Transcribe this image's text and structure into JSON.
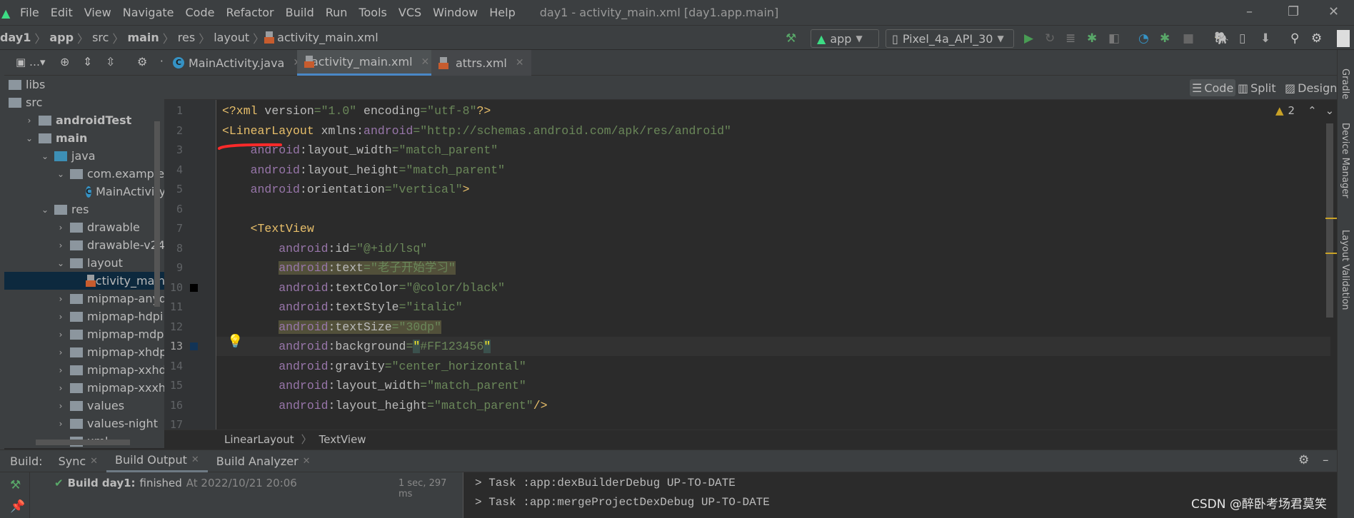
{
  "window": {
    "title": "day1 - activity_main.xml [day1.app.main]",
    "menu": [
      "File",
      "Edit",
      "View",
      "Navigate",
      "Code",
      "Refactor",
      "Build",
      "Run",
      "Tools",
      "VCS",
      "Window",
      "Help"
    ]
  },
  "navbar": {
    "breadcrumbs": [
      "day1",
      "app",
      "src",
      "main",
      "res",
      "layout",
      "activity_main.xml"
    ],
    "run_config": "app",
    "device": "Pixel_4a_API_30"
  },
  "tabs": [
    {
      "label": "MainActivity.java",
      "icon": "java-class-icon",
      "active": false
    },
    {
      "label": "activity_main.xml",
      "icon": "xml-file-icon",
      "active": true
    },
    {
      "label": "attrs.xml",
      "icon": "xml-file-icon",
      "active": false
    }
  ],
  "view_modes": {
    "code": "Code",
    "split": "Split",
    "design": "Design",
    "active": "Code"
  },
  "project_tree": [
    {
      "label": "libs",
      "depth": 0,
      "chev": "",
      "bold": false
    },
    {
      "label": "src",
      "depth": 0,
      "chev": "",
      "bold": false
    },
    {
      "label": "androidTest",
      "depth": 1,
      "chev": "›",
      "bold": true
    },
    {
      "label": "main",
      "depth": 1,
      "chev": "⌄",
      "bold": true
    },
    {
      "label": "java",
      "depth": 2,
      "chev": "⌄",
      "bold": false,
      "blue": true
    },
    {
      "label": "com.example.day",
      "depth": 3,
      "chev": "⌄",
      "bold": false
    },
    {
      "label": "MainActivity",
      "depth": 4,
      "chev": "",
      "bold": false,
      "type": "class"
    },
    {
      "label": "res",
      "depth": 2,
      "chev": "⌄",
      "bold": false
    },
    {
      "label": "drawable",
      "depth": 3,
      "chev": "›",
      "bold": false
    },
    {
      "label": "drawable-v24",
      "depth": 3,
      "chev": "›",
      "bold": false
    },
    {
      "label": "layout",
      "depth": 3,
      "chev": "⌄",
      "bold": false
    },
    {
      "label": "activity_main.x",
      "depth": 4,
      "chev": "",
      "bold": false,
      "type": "xml",
      "selected": true
    },
    {
      "label": "mipmap-anydpi-v",
      "depth": 3,
      "chev": "›",
      "bold": false
    },
    {
      "label": "mipmap-hdpi",
      "depth": 3,
      "chev": "›",
      "bold": false
    },
    {
      "label": "mipmap-mdpi",
      "depth": 3,
      "chev": "›",
      "bold": false
    },
    {
      "label": "mipmap-xhdpi",
      "depth": 3,
      "chev": "›",
      "bold": false
    },
    {
      "label": "mipmap-xxhdpi",
      "depth": 3,
      "chev": "›",
      "bold": false
    },
    {
      "label": "mipmap-xxxhdpi",
      "depth": 3,
      "chev": "›",
      "bold": false
    },
    {
      "label": "values",
      "depth": 3,
      "chev": "›",
      "bold": false
    },
    {
      "label": "values-night",
      "depth": 3,
      "chev": "›",
      "bold": false
    },
    {
      "label": "xml",
      "depth": 3,
      "chev": "›",
      "bold": false
    }
  ],
  "editor": {
    "warnings": "2",
    "current_line": 13,
    "lines": [
      [
        [
          "tag",
          "<?xml "
        ],
        [
          "attr",
          "version"
        ],
        [
          "str",
          "=\"1.0\" "
        ],
        [
          "attr",
          "encoding"
        ],
        [
          "str",
          "=\"utf-8\""
        ],
        [
          "tag",
          "?>"
        ]
      ],
      [
        [
          "tag",
          "<LinearLayout "
        ],
        [
          "attr",
          "xmlns:"
        ],
        [
          "ns",
          "android"
        ],
        [
          "str",
          "=\"http://schemas.android.com/apk/res/android\""
        ]
      ],
      [
        [
          "plain",
          "    "
        ],
        [
          "ns",
          "android"
        ],
        [
          "attr",
          ":layout_width"
        ],
        [
          "str",
          "=\"match_parent\""
        ]
      ],
      [
        [
          "plain",
          "    "
        ],
        [
          "ns",
          "android"
        ],
        [
          "attr",
          ":layout_height"
        ],
        [
          "str",
          "=\"match_parent\""
        ]
      ],
      [
        [
          "plain",
          "    "
        ],
        [
          "ns",
          "android"
        ],
        [
          "attr",
          ":orientation"
        ],
        [
          "str",
          "=\"vertical\""
        ],
        [
          "tag",
          ">"
        ]
      ],
      [],
      [
        [
          "plain",
          "    "
        ],
        [
          "tag",
          "<TextView"
        ]
      ],
      [
        [
          "plain",
          "        "
        ],
        [
          "ns",
          "android"
        ],
        [
          "attr",
          ":id"
        ],
        [
          "str",
          "=\"@+id/lsq\""
        ]
      ],
      [
        [
          "plain",
          "        "
        ],
        [
          "ns",
          "android",
          "hl"
        ],
        [
          "attr",
          ":text",
          "hl"
        ],
        [
          "str",
          "=\"老子开始学习\"",
          "hl"
        ]
      ],
      [
        [
          "plain",
          "        "
        ],
        [
          "ns",
          "android"
        ],
        [
          "attr",
          ":textColor"
        ],
        [
          "str",
          "=\"@color/black\""
        ]
      ],
      [
        [
          "plain",
          "        "
        ],
        [
          "ns",
          "android"
        ],
        [
          "attr",
          ":textStyle"
        ],
        [
          "str",
          "=\"italic\""
        ]
      ],
      [
        [
          "plain",
          "        "
        ],
        [
          "ns",
          "android",
          "hl"
        ],
        [
          "attr",
          ":textSize",
          "hl"
        ],
        [
          "str",
          "=\"30dp\"",
          "hl"
        ]
      ],
      [
        [
          "plain",
          "        "
        ],
        [
          "ns",
          "android"
        ],
        [
          "attr",
          ":background"
        ],
        [
          "str",
          "="
        ],
        [
          "str",
          "\"",
          "brace"
        ],
        [
          "str",
          "#FF123456"
        ],
        [
          "str",
          "\"",
          "brace"
        ]
      ],
      [
        [
          "plain",
          "        "
        ],
        [
          "ns",
          "android"
        ],
        [
          "attr",
          ":gravity"
        ],
        [
          "str",
          "=\"center_horizontal\""
        ]
      ],
      [
        [
          "plain",
          "        "
        ],
        [
          "ns",
          "android"
        ],
        [
          "attr",
          ":layout_width"
        ],
        [
          "str",
          "=\"match_parent\""
        ]
      ],
      [
        [
          "plain",
          "        "
        ],
        [
          "ns",
          "android"
        ],
        [
          "attr",
          ":layout_height"
        ],
        [
          "str",
          "=\"match_parent\""
        ],
        [
          "tag",
          "/>"
        ]
      ],
      []
    ],
    "gutter_colors": {
      "10": "#000000",
      "13": "#123456"
    },
    "breadcrumb": [
      "LinearLayout",
      "TextView"
    ]
  },
  "right_strip": [
    "Gradle",
    "Device Manager",
    "Layout Validation"
  ],
  "build": {
    "label": "Build:",
    "tabs": [
      "Sync",
      "Build Output",
      "Build Analyzer"
    ],
    "active_tab": "Build Output",
    "status_title": "Build day1:",
    "status_text": "finished",
    "status_time": "At 2022/10/21 20:06",
    "duration": "1 sec, 297 ms",
    "output": [
      "> Task :app:dexBuilderDebug UP-TO-DATE",
      "> Task :app:mergeProjectDexDebug UP-TO-DATE"
    ]
  },
  "watermark": "CSDN @醉卧考场君莫笑"
}
